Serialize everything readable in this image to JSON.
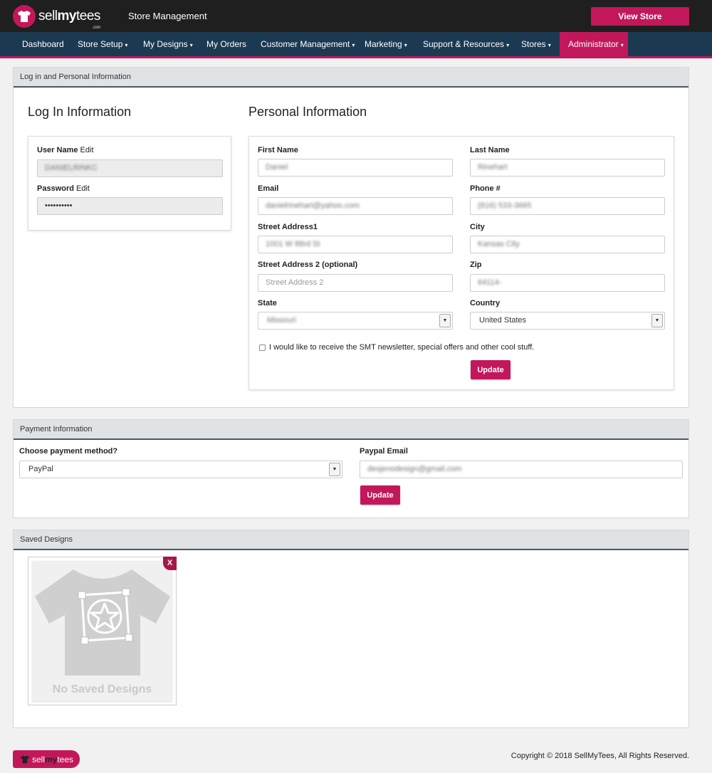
{
  "header": {
    "brand_sell": "sell",
    "brand_my": "my",
    "brand_tees": "tees",
    "brand_com": ".com",
    "section": "Store Management",
    "view_store": "View Store"
  },
  "nav": {
    "items": [
      {
        "label": "Dashboard",
        "caret": ""
      },
      {
        "label": "Store Setup",
        "caret": "▾"
      },
      {
        "label": "My Designs",
        "caret": "▾"
      },
      {
        "label": "My Orders",
        "caret": ""
      },
      {
        "label": "Customer Management",
        "caret": "▾"
      },
      {
        "label": "Marketing",
        "caret": "▾"
      },
      {
        "label": "Support & Resources",
        "caret": "▾"
      },
      {
        "label": "Stores",
        "caret": "▾"
      },
      {
        "label": "Administrator",
        "caret": "▾",
        "active": true
      }
    ]
  },
  "login_panel": {
    "heading": "Log in and Personal Information",
    "login_title": "Log In Information",
    "personal_title": "Personal Information",
    "username_label": "User Name",
    "username_edit": "Edit",
    "username_value": "DANIELRINKC",
    "password_label": "Password",
    "password_edit": "Edit",
    "password_value": "••••••••••"
  },
  "personal": {
    "first_name_label": "First Name",
    "first_name_value": "Daniel",
    "last_name_label": "Last Name",
    "last_name_value": "Rinehart",
    "email_label": "Email",
    "email_value": "danielrinehart@yahoo.com",
    "phone_label": "Phone #",
    "phone_value": "(816) 533-3665",
    "street1_label": "Street Address1",
    "street1_value": "1001 W 88rd St",
    "city_label": "City",
    "city_value": "Kansas City",
    "street2_label": "Street Address 2 (optional)",
    "street2_placeholder": "Street Address 2",
    "zip_label": "Zip",
    "zip_value": "64114-",
    "state_label": "State",
    "state_value": "Missouri",
    "country_label": "Country",
    "country_value": "United States",
    "newsletter_label": "I would like to receive the SMT newsletter, special offers and other cool stuff.",
    "newsletter_checked": false,
    "update": "Update"
  },
  "payment": {
    "heading": "Payment Information",
    "method_label": "Choose payment method?",
    "method_value": "PayPal",
    "paypal_label": "Paypal Email",
    "paypal_value": "desjenodesign@gmail.com",
    "update": "Update"
  },
  "saved": {
    "heading": "Saved Designs",
    "remove": "X",
    "empty_text": "No Saved Designs"
  },
  "footer": {
    "logo_sell": "sell",
    "logo_my": "my",
    "logo_tees": "tees",
    "copyright": "Copyright © 2018 SellMyTees, All Rights Reserved."
  },
  "colors": {
    "brand": "#c2185b",
    "nav_bg": "#1b3a52",
    "topbar_bg": "#1f1f1f"
  }
}
